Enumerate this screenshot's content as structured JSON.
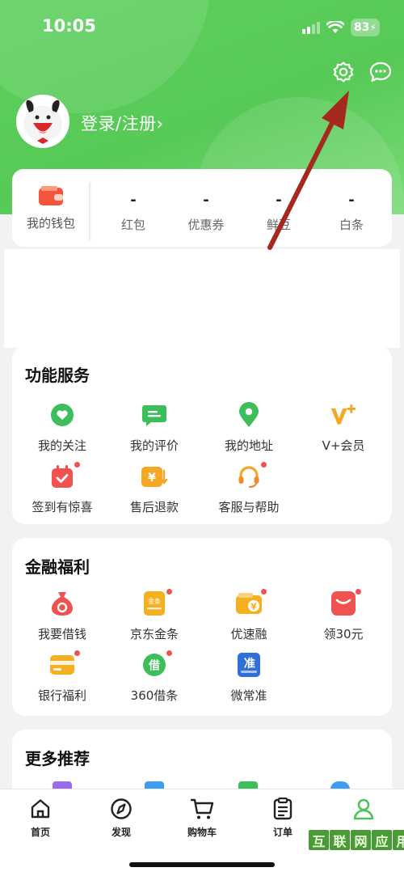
{
  "status_bar": {
    "time": "10:05",
    "battery": "83"
  },
  "header": {
    "login_label": "登录/注册›"
  },
  "wallet": {
    "main_label": "我的钱包",
    "stats": [
      {
        "value": "-",
        "label": "红包"
      },
      {
        "value": "-",
        "label": "优惠券"
      },
      {
        "value": "-",
        "label": "鲜豆"
      },
      {
        "value": "-",
        "label": "白条"
      }
    ]
  },
  "services": {
    "title": "功能服务",
    "items": [
      {
        "label": "我的关注",
        "icon": "heart-icon"
      },
      {
        "label": "我的评价",
        "icon": "comment-icon"
      },
      {
        "label": "我的地址",
        "icon": "location-icon"
      },
      {
        "label": "V+会员",
        "icon": "vplus-icon"
      },
      {
        "label": "签到有惊喜",
        "icon": "calendar-icon"
      },
      {
        "label": "售后退款",
        "icon": "refund-icon"
      },
      {
        "label": "客服与帮助",
        "icon": "headset-icon"
      }
    ]
  },
  "finance": {
    "title": "金融福利",
    "items": [
      {
        "label": "我要借钱",
        "icon": "money-bag-icon"
      },
      {
        "label": "京东金条",
        "icon": "gold-bar-icon",
        "icon_text": "金条"
      },
      {
        "label": "优速融",
        "icon": "wallet-yen-icon"
      },
      {
        "label": "领30元",
        "icon": "red-packet-icon"
      },
      {
        "label": "银行福利",
        "icon": "bank-card-icon"
      },
      {
        "label": "360借条",
        "icon": "loan-icon",
        "icon_text": "借"
      },
      {
        "label": "微常准",
        "icon": "weichangzhun-icon",
        "icon_text": "准"
      }
    ]
  },
  "more": {
    "title": "更多推荐"
  },
  "tabbar": {
    "tabs": [
      {
        "label": "首页",
        "icon": "home-icon"
      },
      {
        "label": "发现",
        "icon": "compass-icon"
      },
      {
        "label": "购物车",
        "icon": "cart-icon"
      },
      {
        "label": "订单",
        "icon": "order-icon"
      },
      {
        "label": "",
        "icon": "profile-icon"
      }
    ]
  },
  "watermark": {
    "chars": [
      "互",
      "联",
      "网",
      "应",
      "用"
    ]
  },
  "colors": {
    "brand_green": "#57c956",
    "tab_active": "#4cc35a",
    "badge_red": "#f0524f"
  }
}
